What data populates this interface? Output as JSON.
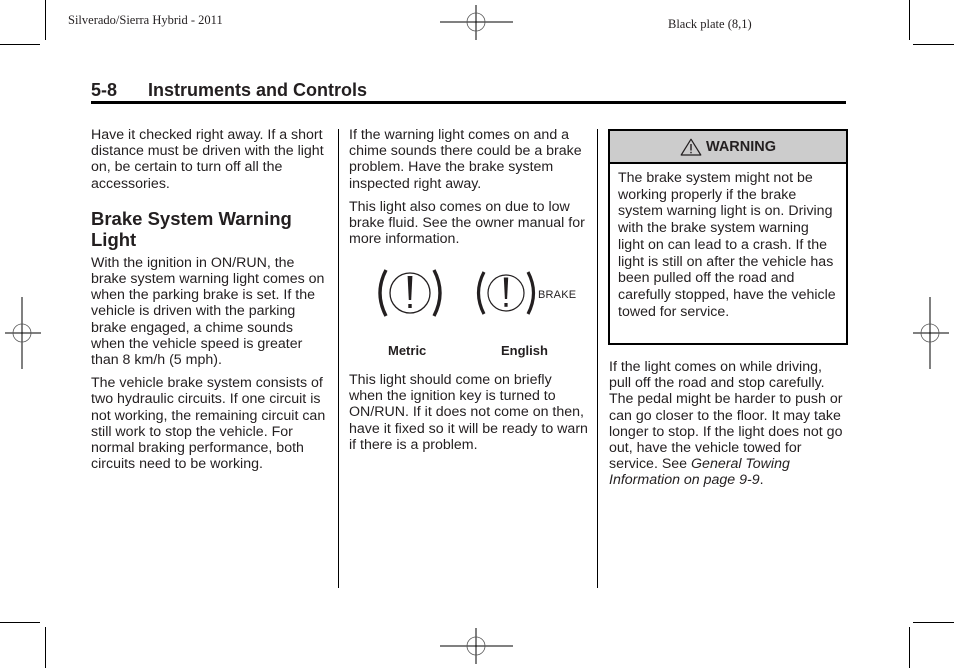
{
  "page_header": {
    "left": "Silverado/Sierra Hybrid - 2011",
    "right": "Black plate (8,1)"
  },
  "section": {
    "number": "5-8",
    "title": "Instruments and Controls"
  },
  "column1": {
    "intro": "Have it checked right away. If a short distance must be driven with the light on, be certain to turn off all the accessories.",
    "heading": "Brake System Warning Light",
    "paragraphs": [
      "With the ignition in ON/RUN, the brake system warning light comes on when the parking brake is set. If the vehicle is driven with the parking brake engaged, a chime sounds when the vehicle speed is greater than 8 km/h (5 mph).",
      "The vehicle brake system consists of two hydraulic circuits. If one circuit is not working, the remaining circuit can still work to stop the vehicle. For normal braking performance, both circuits need to be working."
    ]
  },
  "column2": {
    "paragraphs": [
      "If the warning light comes on and a chime sounds there could be a brake problem. Have the brake system inspected right away.",
      "This light also comes on due to low brake fluid. See the owner manual for more information."
    ],
    "icons": {
      "metric_icon": "brake-warning-icon",
      "english_icon": "brake-warning-icon",
      "english_text": "BRAKE",
      "metric_label": "Metric",
      "english_label": "English"
    },
    "after_icons": "This light should come on briefly when the ignition key is turned to ON/RUN. If it does not come on then, have it fixed so it will be ready to warn if there is a problem."
  },
  "column3": {
    "warning": {
      "icon": "warning-triangle-icon",
      "label": "WARNING",
      "header_color": "#cccccc",
      "text": "The brake system might not be working properly if the brake system warning light is on. Driving with the brake system warning light on can lead to a crash. If the light is still on after the vehicle has been pulled off the road and carefully stopped, have the vehicle towed for service."
    },
    "paragraph_text": "If the light comes on while driving, pull off the road and stop carefully. The pedal might be harder to push or can go closer to the floor. It may take longer to stop. If the light does not go out, have the vehicle towed for service. See ",
    "paragraph_link": "General Towing Information on page 9-9",
    "paragraph_end": "."
  }
}
